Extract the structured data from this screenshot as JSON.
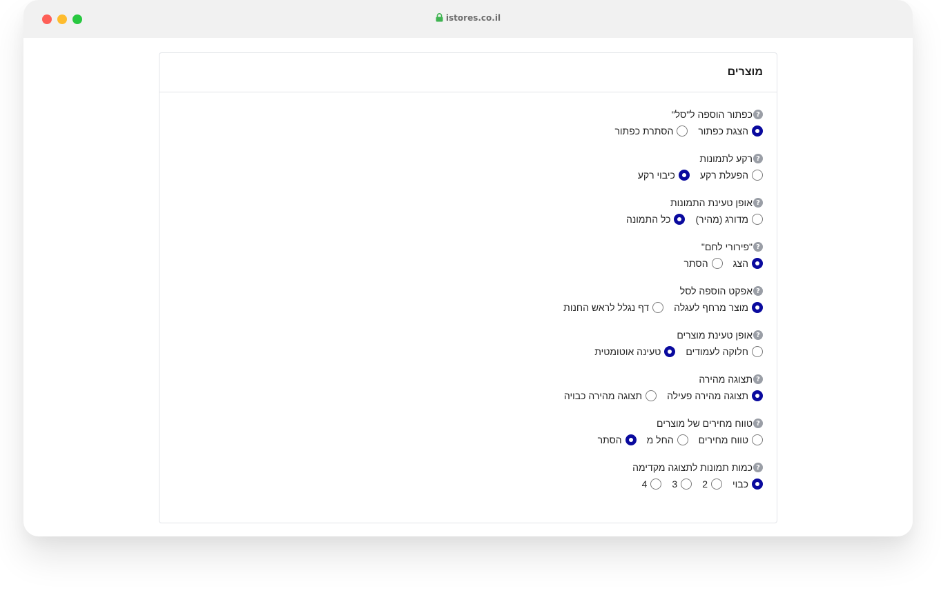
{
  "browser": {
    "url": "istores.co.il"
  },
  "card": {
    "title": "מוצרים"
  },
  "groups": [
    {
      "label": "כפתור הוספה ל\"סל\"",
      "options": [
        {
          "label": "הצגת כפתור",
          "checked": true
        },
        {
          "label": "הסתרת כפתור",
          "checked": false
        }
      ]
    },
    {
      "label": "רקע לתמונות",
      "options": [
        {
          "label": "הפעלת רקע",
          "checked": false
        },
        {
          "label": "כיבוי רקע",
          "checked": true
        }
      ]
    },
    {
      "label": "אופן טעינת התמונות",
      "options": [
        {
          "label": "מדורג (מהיר)",
          "checked": false
        },
        {
          "label": "כל התמונה",
          "checked": true
        }
      ]
    },
    {
      "label": "\"פירורי לחם\"",
      "options": [
        {
          "label": "הצג",
          "checked": true
        },
        {
          "label": "הסתר",
          "checked": false
        }
      ]
    },
    {
      "label": "אפקט הוספה לסל",
      "options": [
        {
          "label": "מוצר מרחף לעגלה",
          "checked": true
        },
        {
          "label": "דף נגלל לראש החנות",
          "checked": false
        }
      ]
    },
    {
      "label": "אופן טעינת מוצרים",
      "options": [
        {
          "label": "חלוקה לעמודים",
          "checked": false
        },
        {
          "label": "טעינה אוטומטית",
          "checked": true
        }
      ]
    },
    {
      "label": "תצוגה מהירה",
      "options": [
        {
          "label": "תצוגה מהירה פעילה",
          "checked": true
        },
        {
          "label": "תצוגה מהירה כבויה",
          "checked": false
        }
      ]
    },
    {
      "label": "טווח מחירים של מוצרים",
      "options": [
        {
          "label": "טווח מחירים",
          "checked": false
        },
        {
          "label": "החל מ",
          "checked": false
        },
        {
          "label": "הסתר",
          "checked": true
        }
      ]
    },
    {
      "label": "כמות תמונות לתצוגה מקדימה",
      "options": [
        {
          "label": "כבוי",
          "checked": true
        },
        {
          "label": "2",
          "checked": false
        },
        {
          "label": "3",
          "checked": false
        },
        {
          "label": "4",
          "checked": false
        }
      ]
    }
  ]
}
